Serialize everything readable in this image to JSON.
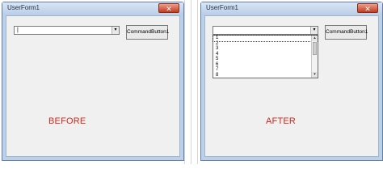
{
  "before": {
    "window_title": "UserForm1",
    "close_glyph": "✕",
    "combo_value": "|",
    "command_button": "CommandButton1",
    "caption": "BEFORE"
  },
  "after": {
    "window_title": "UserForm1",
    "close_glyph": "✕",
    "combo_value": "",
    "command_button": "CommandButton1",
    "list_items": [
      "1",
      "2",
      "3",
      "4",
      "5",
      "6",
      "7",
      "8"
    ],
    "caption": "AFTER"
  },
  "icons": {
    "dropdown_arrow": "▾",
    "scroll_up": "▴",
    "scroll_down": "▾"
  },
  "colors": {
    "caption_red": "#d0281e",
    "window_frame": "#bcd0e8",
    "close_button": "#c23a1f"
  }
}
